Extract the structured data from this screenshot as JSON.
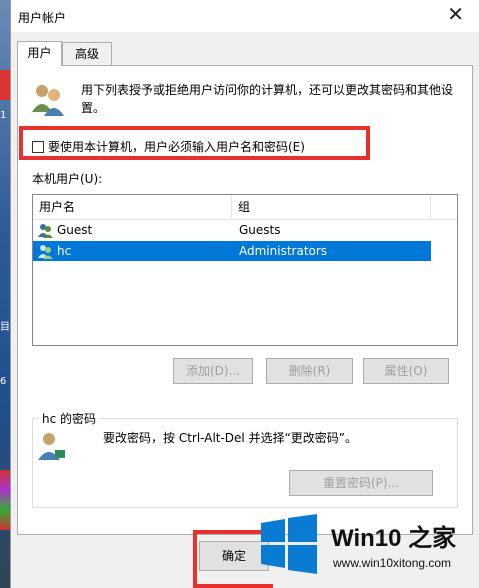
{
  "window": {
    "title": "用户帐户",
    "close_glyph": "✕"
  },
  "tabs": [
    {
      "label": "用户",
      "active": true
    },
    {
      "label": "高级",
      "active": false
    }
  ],
  "description": "用下列表授予或拒绝用户访问你的计算机，还可以更改其密码和其他设置。",
  "require_password_checkbox": {
    "label": "要使用本计算机，用户必须输入用户名和密码(E)",
    "checked": false
  },
  "users_label": "本机用户(U):",
  "users_table": {
    "columns": [
      "用户名",
      "组"
    ],
    "rows": [
      {
        "name": "Guest",
        "group": "Guests",
        "selected": false
      },
      {
        "name": "hc",
        "group": "Administrators",
        "selected": true
      }
    ]
  },
  "buttons": {
    "add": "添加(D)...",
    "remove": "删除(R)",
    "properties": "属性(O)",
    "reset_password": "重置密码(P)...",
    "ok": "确定"
  },
  "password_section": {
    "title": "hc 的密码",
    "text": "要改密码，按 Ctrl-Alt-Del 并选择“更改密码”。"
  },
  "watermark": {
    "title": "Win10 之家",
    "url": "www.win10xitong.com"
  },
  "colors": {
    "selection": "#0078d7",
    "highlight_red": "#e8312f",
    "win_logo_blue": "#0a7bd3"
  }
}
